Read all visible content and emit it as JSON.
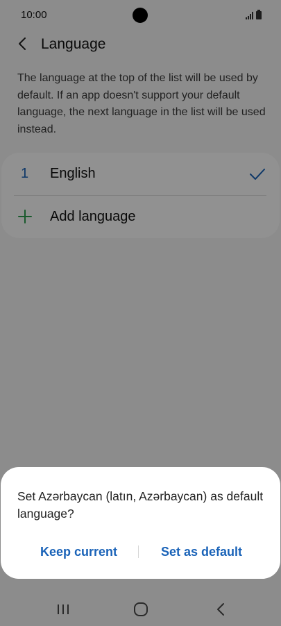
{
  "status_bar": {
    "time": "10:00"
  },
  "header": {
    "title": "Language"
  },
  "description": "The language at the top of the list will be used by default. If an app doesn't support your default language, the next language in the list will be used instead.",
  "language_list": {
    "items": [
      {
        "index": "1",
        "name": "English",
        "selected": true
      }
    ],
    "add_label": "Add language"
  },
  "dialog": {
    "message": "Set Azərbaycan (latın, Azərbaycan) as default language?",
    "keep_label": "Keep current",
    "set_default_label": "Set as default"
  },
  "colors": {
    "accent": "#1a63b8",
    "add_icon": "#2e9e4f",
    "overlay": "rgba(0,0,0,0.43)"
  },
  "icons": {
    "back": "chevron-left-icon",
    "check": "check-icon",
    "add": "plus-icon",
    "nav_recent": "recent-apps-icon",
    "nav_home": "home-icon",
    "nav_back": "nav-back-icon"
  }
}
